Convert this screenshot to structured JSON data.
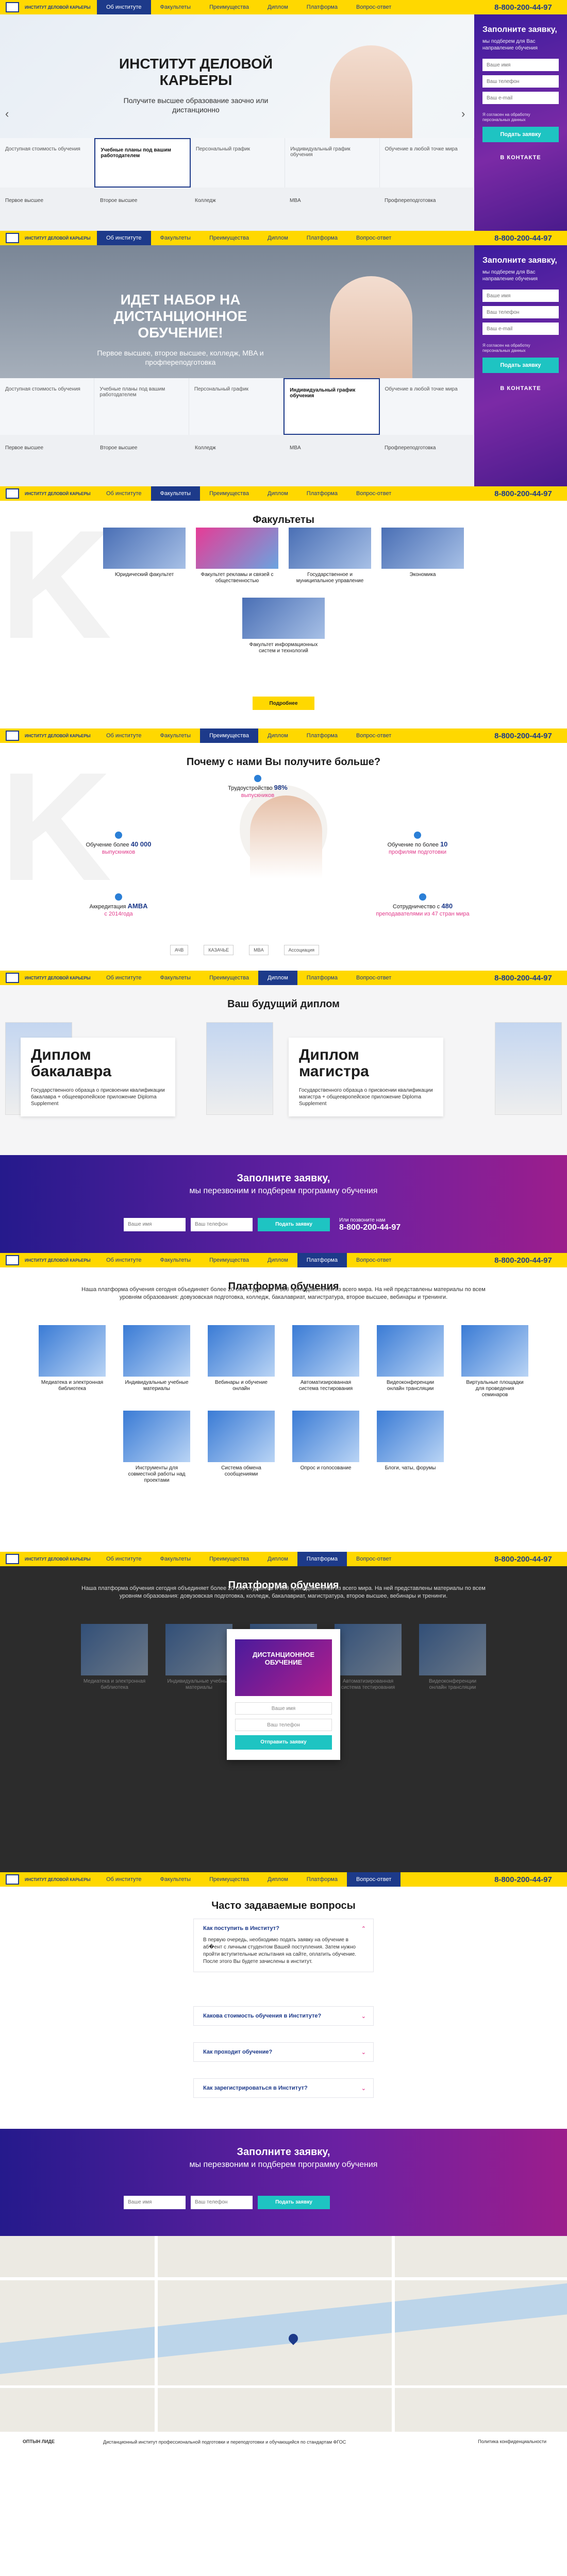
{
  "nav": {
    "brand": "ИНСТИТУТ ДЕЛОВОЙ КАРЬЕРЫ",
    "items": [
      "Об институте",
      "Факультеты",
      "Преимущества",
      "Диплом",
      "Платформа",
      "Вопрос-ответ"
    ],
    "phone": "8-800-200-44-97"
  },
  "hero1": {
    "title": "ИНСТИТУТ ДЕЛОВОЙ КАРЬЕРЫ",
    "subtitle": "Получите высшее образование заочно или дистанционно",
    "strip": [
      "Доступная стоимость обучения",
      "Учебные планы под вашим работодателем",
      "Персональный график",
      "Индивидуальный график обучения",
      "Обучение в любой точке мира"
    ],
    "facs": [
      "Первое высшее",
      "Второе высшее",
      "Колледж",
      "MBA",
      "Профпереподготовка"
    ]
  },
  "form": {
    "title": "Заполните заявку,",
    "sub": "мы подберем для Вас направление обучения",
    "name_ph": "Ваше имя",
    "phone_ph": "Ваш телефон",
    "email_ph": "Ваш e-mail",
    "consent": "Я согласен на обработку персональных данных",
    "button": "Подать заявку",
    "vk": "В КОНТАКТЕ"
  },
  "hero2": {
    "title": "ИДЕТ НАБОР НА ДИСТАНЦИОННОЕ ОБУЧЕНИЕ!",
    "subtitle": "Первое высшее, второе высшее, колледж, MBA и профпереподготовка",
    "strip": [
      "Доступная стоимость обучения",
      "Учебные планы под вашим работодателем",
      "Персональный график",
      "Индивидуальный график обучения",
      "Обучение в любой точке мира"
    ],
    "facs": [
      "Первое высшее",
      "Второе высшее",
      "Колледж",
      "MBA",
      "Профпереподготовка"
    ]
  },
  "faculties": {
    "title": "Факультеты",
    "items": [
      "Юридический факультет",
      "Факультет рекламы и связей с общественностью",
      "Государственное и муниципальное управление",
      "Экономика",
      "Факультет информационных систем и технологий"
    ],
    "button": "Подробнее"
  },
  "why": {
    "title": "Почему с нами Вы получите больше?",
    "stats": [
      {
        "a": "Трудоустройство",
        "b": "98%",
        "c": "выпускников"
      },
      {
        "a": "Обучение более",
        "b": "40 000",
        "c": "выпускников"
      },
      {
        "a": "Обучение по более",
        "b": "10",
        "c": "профилям подготовки"
      },
      {
        "a": "Аккредитация",
        "b": "AMBA",
        "c": "с 2014года"
      },
      {
        "a": "Сотрудничество с",
        "b": "480",
        "c": "преподавателями из 47 стран мира"
      }
    ],
    "logos": [
      "АЧВ",
      "КАЗАЧЬЕ",
      "MBA",
      "Ассоциация"
    ]
  },
  "diploma": {
    "title": "Ваш будущий диплом",
    "cards": [
      {
        "h": "Диплом бакалавра",
        "t": "Государственного образца о присвоении квалификации бакалавра + общеевропейское приложение Diploma Supplement"
      },
      {
        "h": "Диплом магистра",
        "t": "Государственного образца о присвоении квалификации магистра + общеевропейское приложение Diploma Supplement"
      }
    ]
  },
  "fill": {
    "title": "Заполните заявку,",
    "sub": "мы перезвоним и подберем программу обучения",
    "name_ph": "Ваше имя",
    "phone_ph": "Ваш телефон",
    "button": "Подать заявку",
    "phone_lbl": "Или позвоните нам",
    "phone": "8-800-200-44-97"
  },
  "platform": {
    "title": "Платформа обучения",
    "intro": "Наша платформа обучения сегодня объединяет более 20 000 студентов и 300 преподавателей из всего мира. На ней представлены материалы по всем уровням образования: довузовская подготовка, колледж, бакалавриат, магистратура, второе высшее, вебинары и тренинги.",
    "items": [
      "Медиатека и электронная библиотека",
      "Индивидуальные учебные материалы",
      "Вебинары и обучение онлайн",
      "Автоматизированная система тестирования",
      "Видеоконференции онлайн трансляции",
      "Виртуальные площадки для проведения семинаров",
      "Инструменты для совместной работы над проектами",
      "Система обмена сообщениями",
      "Опрос и голосование",
      "Блоги, чаты, форумы"
    ]
  },
  "platform2": {
    "title": "Платформа обучения",
    "modal_banner": "ДИСТАНЦИОННОЕ ОБУЧЕНИЕ",
    "modal_name": "Ваше имя",
    "modal_phone": "Ваш телефон",
    "modal_btn": "Отправить заявку"
  },
  "faq": {
    "title": "Часто задаваемые вопросы",
    "items": [
      {
        "q": "Как поступить в Институт?",
        "a": "В первую очередь, необходимо подать заявку на обучение в аб�ент с личным студентом Вашей поступления. Затем нужно пройти вступительные испытания на сайте, оплатить обучение. После этого Вы будете зачислены в институт."
      },
      {
        "q": "Какова стоимость обучения в Институте?",
        "a": ""
      },
      {
        "q": "Как проходит обучение?",
        "a": ""
      },
      {
        "q": "Как зарегистрироваться в Институт?",
        "a": ""
      }
    ]
  },
  "fill2": {
    "title": "Заполните заявку,",
    "sub": "мы перезвоним и подберем программу обучения"
  },
  "footer": {
    "left": "ОПТЫН ЛИДЕ",
    "center": "Дистанционный институт профессиональной подготовки и переподготовки и обучающийся по стандартам ФГОС",
    "right": "Политика конфиденциальности"
  }
}
